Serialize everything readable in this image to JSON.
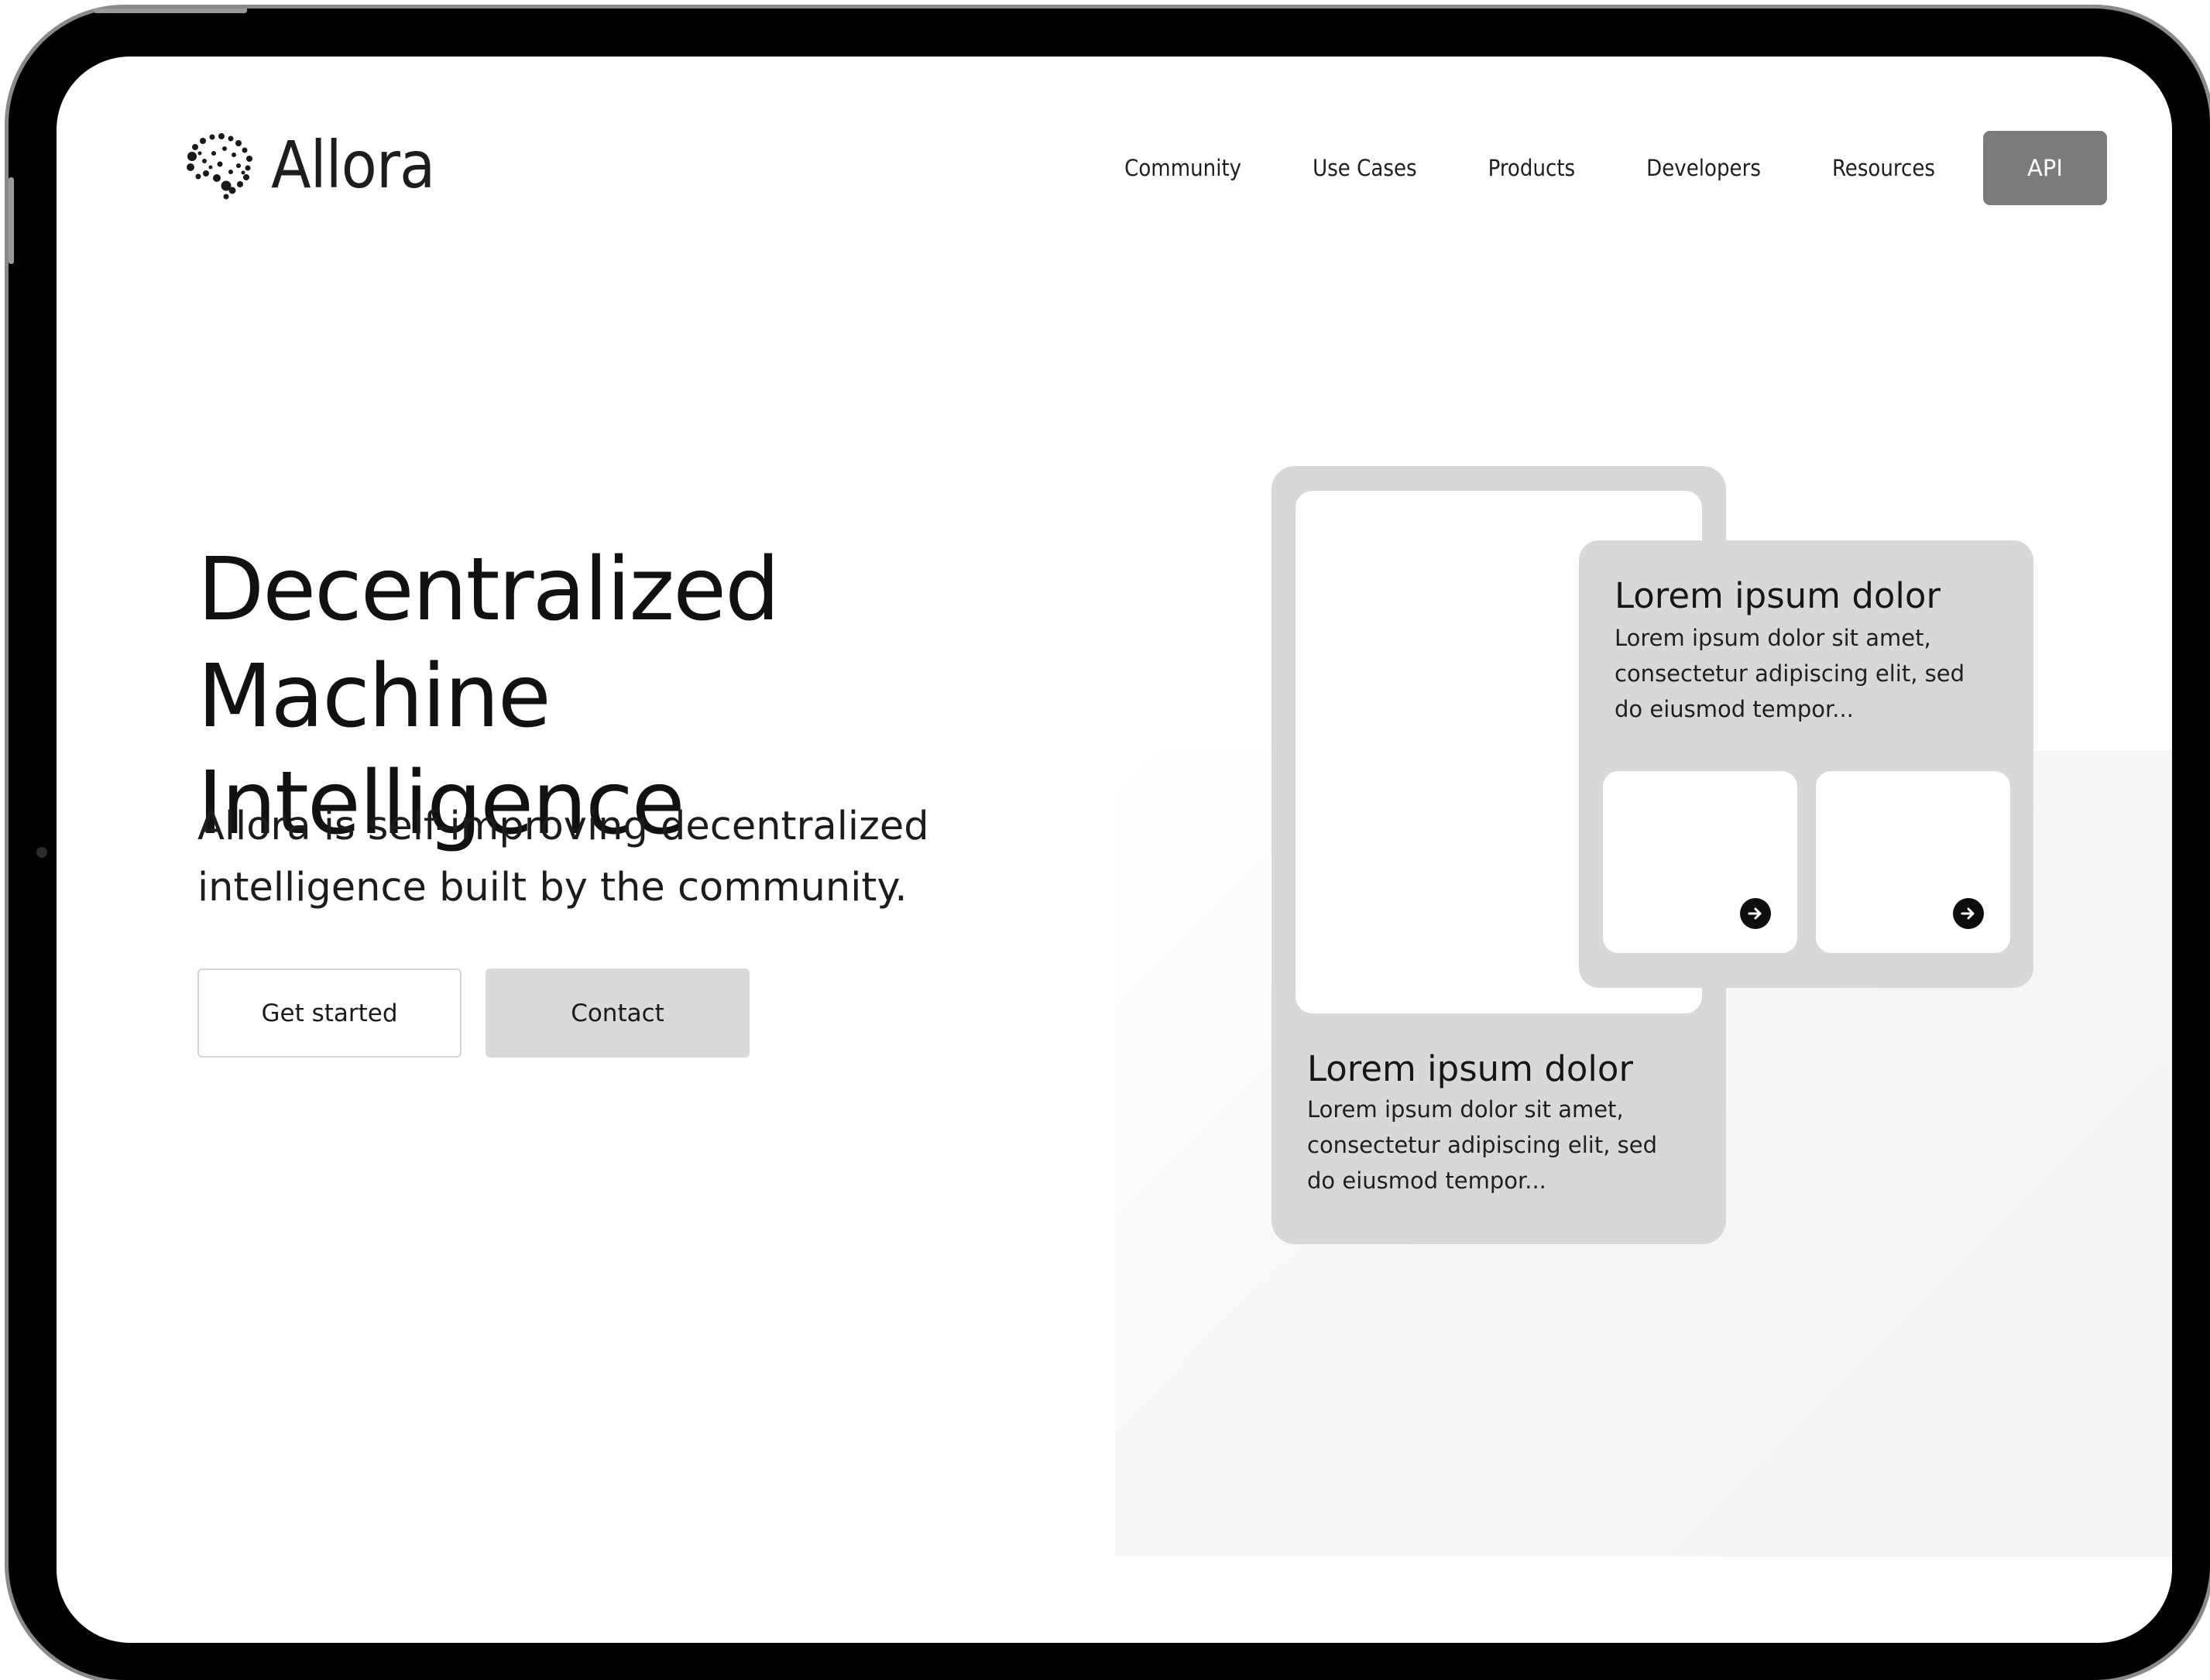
{
  "brand": {
    "name": "Allora",
    "logo_icon": "neural-dots-icon"
  },
  "nav": {
    "items": [
      "Community",
      "Use Cases",
      "Products",
      "Developers",
      "Resources"
    ],
    "cta_label": "API"
  },
  "hero": {
    "title_line1": "Decentralized Machine",
    "title_line2": "Intelligence",
    "subtitle_line1": "Allora is self-improving decentralized",
    "subtitle_line2": "intelligence built by the community.",
    "primary_button": "Get started",
    "secondary_button": "Contact"
  },
  "cards": {
    "back": {
      "title": "Lorem ipsum dolor",
      "body_line1": "Lorem ipsum dolor sit amet,",
      "body_line2": "consectetur adipiscing elit, sed",
      "body_line3": "do eiusmod tempor..."
    },
    "front": {
      "title": "Lorem ipsum dolor",
      "body_line1": "Lorem ipsum dolor sit amet,",
      "body_line2": "consectetur adipiscing elit, sed",
      "body_line3": "do eiusmod tempor...",
      "action_icon": "arrow-right-icon"
    }
  },
  "colors": {
    "api_button": "#7b7b7b",
    "card_gray": "#d8d8d8",
    "secondary_button": "#d9d9d9",
    "text": "#111111"
  }
}
